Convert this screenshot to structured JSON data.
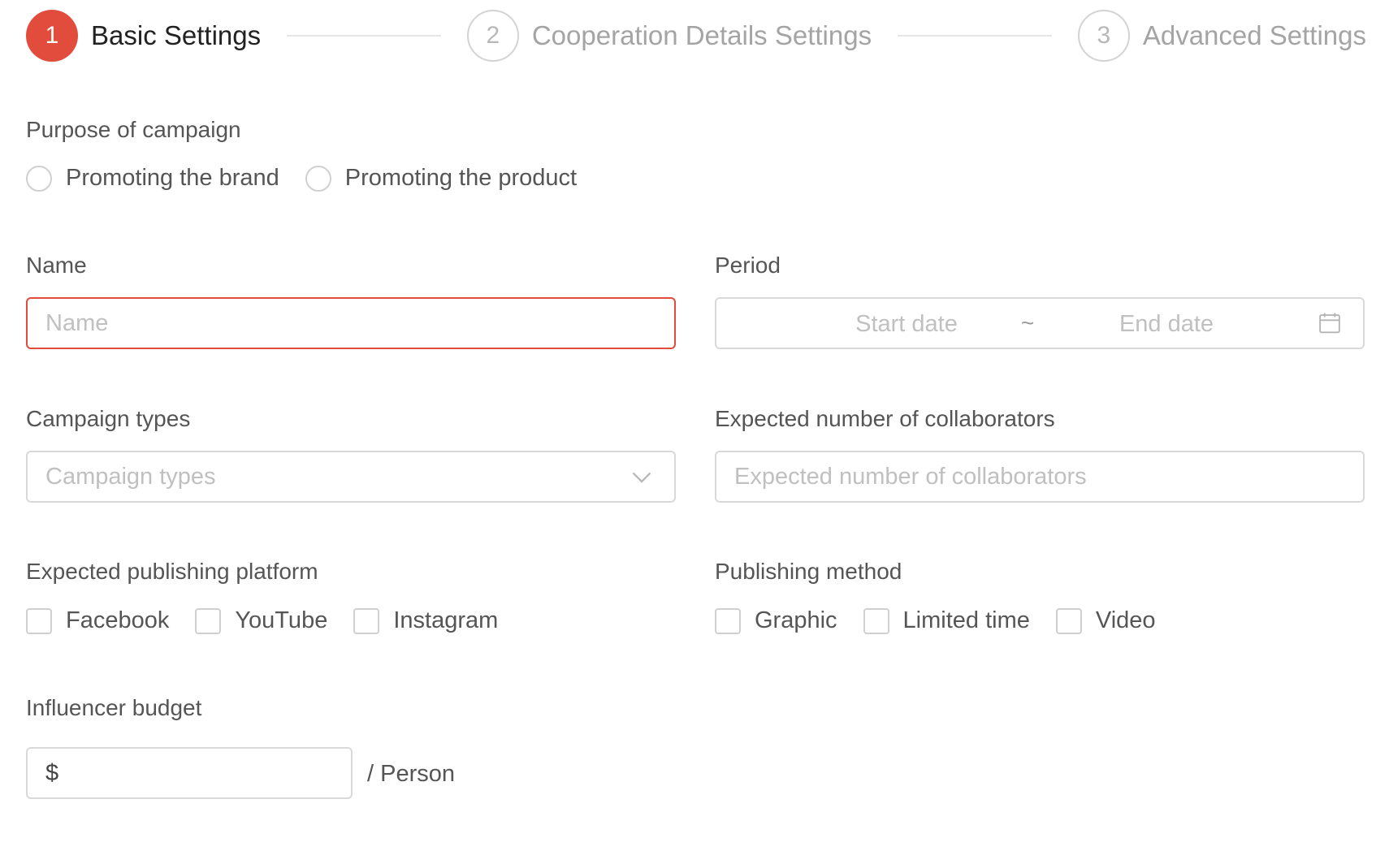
{
  "steps": [
    {
      "number": "1",
      "label": "Basic Settings",
      "state": "active"
    },
    {
      "number": "2",
      "label": "Cooperation Details Settings",
      "state": "inactive"
    },
    {
      "number": "3",
      "label": "Advanced Settings",
      "state": "inactive"
    }
  ],
  "purpose": {
    "label": "Purpose of campaign",
    "options": [
      "Promoting the brand",
      "Promoting the product"
    ]
  },
  "name": {
    "label": "Name",
    "placeholder": "Name",
    "value": ""
  },
  "period": {
    "label": "Period",
    "start_placeholder": "Start date",
    "separator": "~",
    "end_placeholder": "End date"
  },
  "campaign_types": {
    "label": "Campaign types",
    "placeholder": "Campaign types"
  },
  "collaborators": {
    "label": "Expected number of collaborators",
    "placeholder": "Expected number of collaborators",
    "value": ""
  },
  "platform": {
    "label": "Expected publishing platform",
    "options": [
      "Facebook",
      "YouTube",
      "Instagram"
    ]
  },
  "method": {
    "label": "Publishing method",
    "options": [
      "Graphic",
      "Limited time",
      "Video"
    ]
  },
  "budget": {
    "label": "Influencer budget",
    "prefix": "$",
    "suffix": "/ Person",
    "value": ""
  },
  "colors": {
    "accent": "#e24c3c",
    "border": "#d9d9d9",
    "placeholder": "#c0c0c0"
  }
}
